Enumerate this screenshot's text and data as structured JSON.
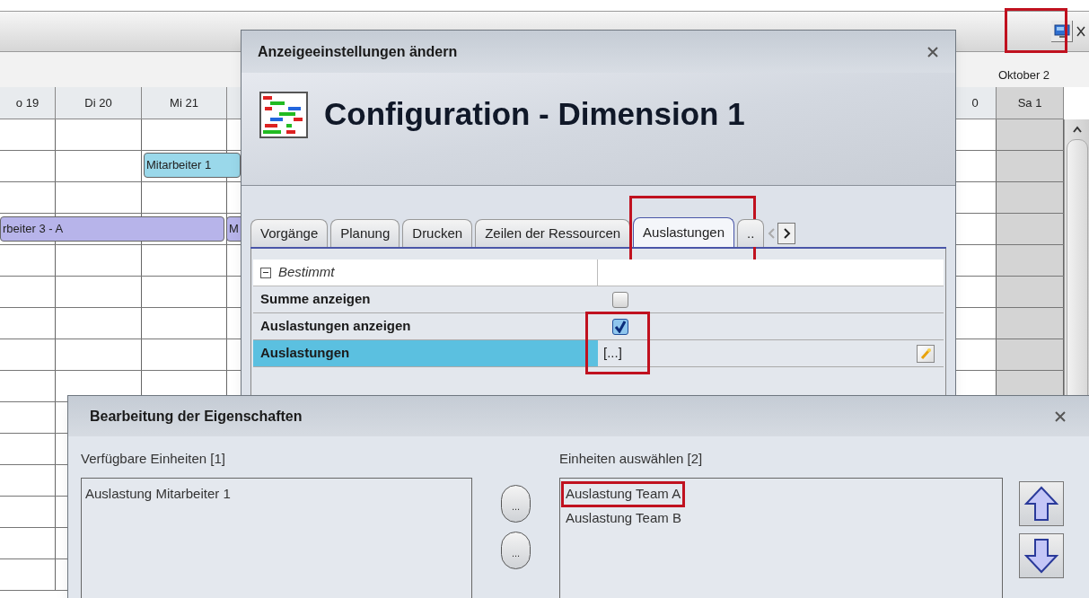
{
  "toolbar": {
    "settings_button": {
      "highlighted": true
    }
  },
  "gantt": {
    "month_label": "Oktober 2",
    "days": [
      {
        "label": "o 19",
        "weekend": false
      },
      {
        "label": "Di 20",
        "weekend": false
      },
      {
        "label": "Mi 21",
        "weekend": false
      },
      {
        "label": "0",
        "weekend": false
      },
      {
        "label": "Sa 1",
        "weekend": true
      }
    ],
    "bars": [
      {
        "label": "Mitarbeiter 1",
        "color": "#9ad8ea"
      },
      {
        "label": "rbeiter 3 - A",
        "color": "#b7b4ea"
      },
      {
        "label": "M",
        "color": "#b7b4ea"
      }
    ]
  },
  "settings_dialog": {
    "title": "Anzeigeeinstellungen ändern",
    "banner_title": "Configuration - Dimension 1",
    "tabs": [
      {
        "label": "Vorgänge",
        "selected": false,
        "highlighted": false
      },
      {
        "label": "Planung",
        "selected": false,
        "highlighted": false
      },
      {
        "label": "Drucken",
        "selected": false,
        "highlighted": false
      },
      {
        "label": "Zeilen der Ressourcen",
        "selected": false,
        "highlighted": false
      },
      {
        "label": "Auslastungen",
        "selected": true,
        "highlighted": true
      },
      {
        "label": "..",
        "selected": false,
        "highlighted": false
      }
    ],
    "properties": {
      "category": {
        "label": "Bestimmt",
        "expanded": true
      },
      "rows": [
        {
          "name": "Summe anzeigen",
          "kind": "checkbox",
          "checked": false,
          "selected": false,
          "highlighted": false
        },
        {
          "name": "Auslastungen anzeigen",
          "kind": "checkbox",
          "checked": true,
          "selected": false,
          "highlighted": true
        },
        {
          "name": "Auslastungen",
          "kind": "collection",
          "value": "[...]",
          "selected": true,
          "highlighted": true
        }
      ]
    }
  },
  "edit_dialog": {
    "title": "Bearbeitung der Eigenschaften",
    "available": {
      "label": "Verfügbare Einheiten [1]",
      "items": [
        {
          "label": "Auslastung Mitarbeiter 1",
          "highlighted": false
        }
      ]
    },
    "transfer_buttons": [
      "...",
      "..."
    ],
    "chosen": {
      "label": "Einheiten auswählen [2]",
      "items": [
        {
          "label": "Auslastung Team A",
          "highlighted": true
        },
        {
          "label": "Auslastung Team B",
          "highlighted": false
        }
      ]
    }
  }
}
